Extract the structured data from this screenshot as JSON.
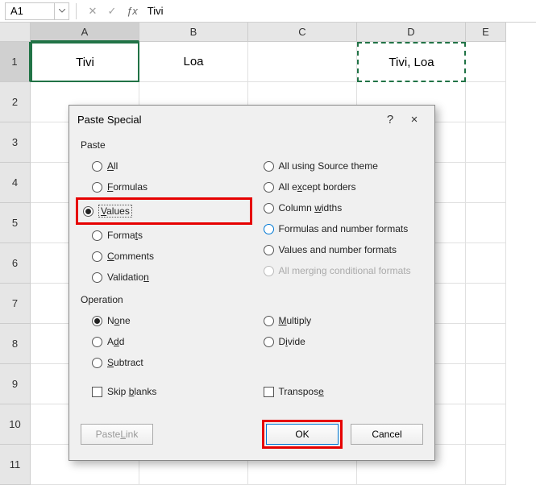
{
  "formula_bar": {
    "name_box": "A1",
    "formula": "Tivi"
  },
  "columns": [
    "A",
    "B",
    "C",
    "D",
    "E"
  ],
  "rows": [
    "1",
    "2",
    "3",
    "4",
    "5",
    "6",
    "7",
    "8",
    "9",
    "10",
    "11"
  ],
  "cells": {
    "A1": "Tivi",
    "B1": "Loa",
    "D1": "Tivi, Loa"
  },
  "dialog": {
    "title": "Paste Special",
    "help": "?",
    "close": "×",
    "group_paste": "Paste",
    "group_operation": "Operation",
    "paste_left": {
      "all": "All",
      "formulas": "Formulas",
      "values": "Values",
      "formats": "Formats",
      "comments": "Comments",
      "validation": "Validation"
    },
    "paste_right": {
      "all_source_theme": "All using Source theme",
      "all_except_borders": "All except borders",
      "column_widths": "Column widths",
      "formulas_number_formats": "Formulas and number formats",
      "values_number_formats": "Values and number formats",
      "all_merging": "All merging conditional formats"
    },
    "op_left": {
      "none": "None",
      "add": "Add",
      "subtract": "Subtract"
    },
    "op_right": {
      "multiply": "Multiply",
      "divide": "Divide"
    },
    "skip_blanks": "Skip blanks",
    "transpose": "Transpose",
    "paste_link": "Paste Link",
    "ok": "OK",
    "cancel": "Cancel"
  }
}
